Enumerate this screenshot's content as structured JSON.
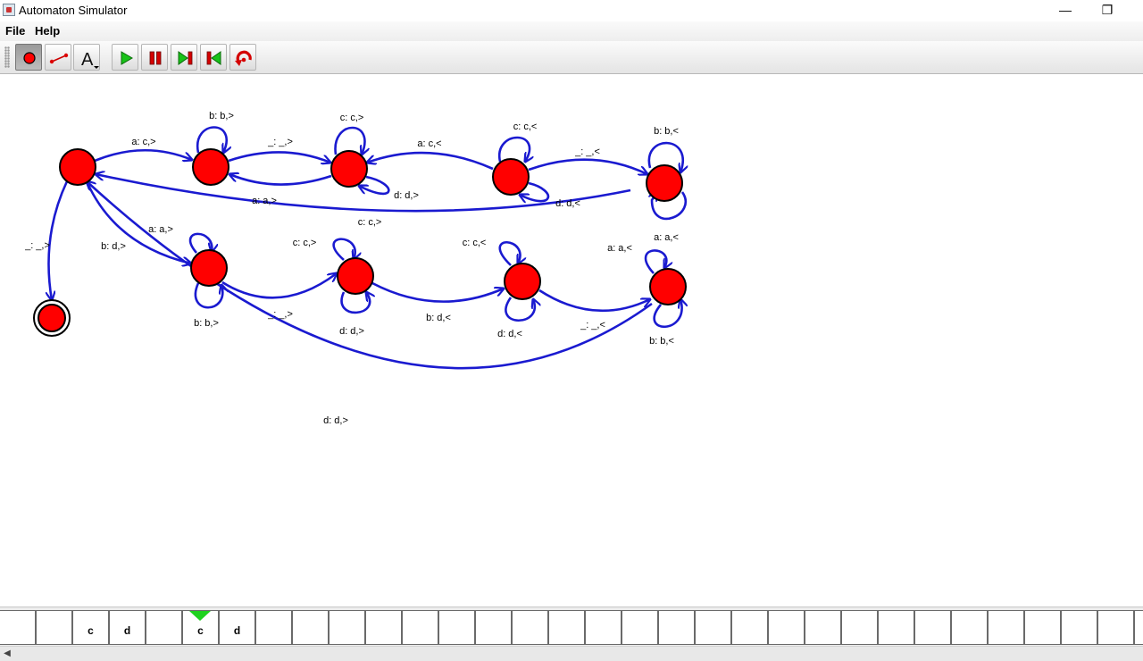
{
  "window": {
    "title": "Automaton Simulator",
    "minimize_glyph": "—",
    "restore_glyph": "❐"
  },
  "menu": [
    "File",
    "Help"
  ],
  "toolbar": {
    "tools": [
      {
        "name": "state-tool",
        "icon": "red-state-circle-icon",
        "pressed": true
      },
      {
        "name": "transition-tool",
        "icon": "transition-line-icon",
        "pressed": false
      },
      {
        "name": "text-tool",
        "icon": "text-letter-a-icon",
        "glyph": "A",
        "pressed": false
      }
    ],
    "controls": [
      {
        "name": "run",
        "icon": "play-icon"
      },
      {
        "name": "pause",
        "icon": "pause-icon"
      },
      {
        "name": "step",
        "icon": "step-forward-icon"
      },
      {
        "name": "step-back",
        "icon": "step-back-icon"
      },
      {
        "name": "reset",
        "icon": "reset-icon"
      }
    ]
  },
  "automaton": {
    "colors": {
      "state_fill": "#ff0000",
      "state_stroke": "#000000",
      "edge": "#1a1ad0"
    },
    "states": [
      {
        "id": "q0",
        "accepting": false
      },
      {
        "id": "q1",
        "accepting": false
      },
      {
        "id": "q2",
        "accepting": false
      },
      {
        "id": "q3",
        "accepting": false
      },
      {
        "id": "q4",
        "accepting": false
      },
      {
        "id": "q5",
        "accepting": false
      },
      {
        "id": "q6",
        "accepting": false
      },
      {
        "id": "q7",
        "accepting": false
      },
      {
        "id": "q8",
        "accepting": false
      },
      {
        "id": "qf",
        "accepting": true
      }
    ],
    "transitions": [
      {
        "from": "q0",
        "to": "q1",
        "label": "a: c,>"
      },
      {
        "from": "q1",
        "to": "q1",
        "label": "b: b,>"
      },
      {
        "from": "q1",
        "to": "q2",
        "label": "_: _,>"
      },
      {
        "from": "q2",
        "to": "q1",
        "label": "a: a,>"
      },
      {
        "from": "q2",
        "to": "q2",
        "label": "c: c,>"
      },
      {
        "from": "q2",
        "to": "q2",
        "label": "d: d,>"
      },
      {
        "from": "q3",
        "to": "q2",
        "label": "a: c,<"
      },
      {
        "from": "q3",
        "to": "q3",
        "label": "c: c,<"
      },
      {
        "from": "q3",
        "to": "q3",
        "label": "d: d,<"
      },
      {
        "from": "q3",
        "to": "q4",
        "label": "_: _,<"
      },
      {
        "from": "q4",
        "to": "q4",
        "label": "b: b,<"
      },
      {
        "from": "q4",
        "to": "q4",
        "label": "a: a,<"
      },
      {
        "from": "q4",
        "to": "q0",
        "label": "c: c,>"
      },
      {
        "from": "q0",
        "to": "qf",
        "label": "_: _,>"
      },
      {
        "from": "q0",
        "to": "q5",
        "label": "b: d,>"
      },
      {
        "from": "q5",
        "to": "q5",
        "label": "a: a,>"
      },
      {
        "from": "q5",
        "to": "q5",
        "label": "b: b,>"
      },
      {
        "from": "q5",
        "to": "q6",
        "label": "_: _,>"
      },
      {
        "from": "q6",
        "to": "q6",
        "label": "c: c,>"
      },
      {
        "from": "q6",
        "to": "q6",
        "label": "d: d,>"
      },
      {
        "from": "q6",
        "to": "q7",
        "label": "b: d,<"
      },
      {
        "from": "q7",
        "to": "q7",
        "label": "c: c,<"
      },
      {
        "from": "q7",
        "to": "q7",
        "label": "d: d,<"
      },
      {
        "from": "q7",
        "to": "q8",
        "label": "_: _,<"
      },
      {
        "from": "q8",
        "to": "q8",
        "label": "a: a,<"
      },
      {
        "from": "q8",
        "to": "q8",
        "label": "b: b,<"
      },
      {
        "from": "q8",
        "to": "q0",
        "label": "d: d,>"
      }
    ]
  },
  "tape": {
    "cells": [
      "",
      "",
      "c",
      "d",
      "",
      "c",
      "d",
      "",
      "",
      "",
      "",
      "",
      "",
      "",
      "",
      "",
      "",
      "",
      "",
      "",
      "",
      "",
      "",
      "",
      "",
      "",
      "",
      "",
      "",
      "",
      "",
      ""
    ],
    "head_index": 5,
    "head_color": "#1fd21f"
  },
  "scrollbar": {
    "left_arrow": "◀"
  }
}
